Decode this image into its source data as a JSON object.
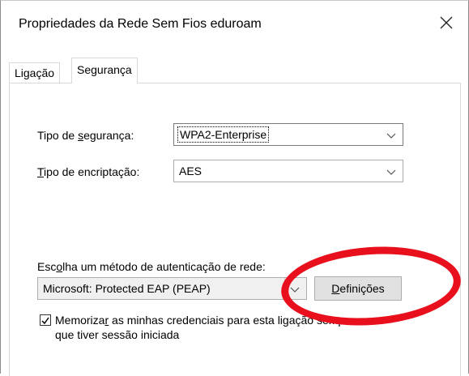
{
  "window": {
    "title": "Propriedades da Rede Sem Fios eduroam",
    "close_icon": "close-icon"
  },
  "tabs": [
    {
      "label": "Ligação",
      "active": false
    },
    {
      "label": "Segurança",
      "active": true
    }
  ],
  "security": {
    "type_label_pre": "Tipo de ",
    "type_label_u": "s",
    "type_label_post": "egurança:",
    "type_value": "WPA2-Enterprise",
    "encryption_label_u": "T",
    "encryption_label_post": "ipo de encriptação:",
    "encryption_value": "AES"
  },
  "auth": {
    "label_pre": "Esc",
    "label_u": "o",
    "label_post": "lha um método de autenticação de rede:",
    "method_value": "Microsoft: Protected EAP (PEAP)",
    "settings_button_u": "D",
    "settings_button_post": "efinições"
  },
  "remember": {
    "checked": true,
    "line1_pre": "Memoriza",
    "line1_u": "r",
    "line1_post": " as minhas credenciais para esta ligação sempre",
    "line2": "que tiver sessão iniciada"
  },
  "annotation": {
    "color": "#e8101d",
    "shape": "ellipse"
  }
}
